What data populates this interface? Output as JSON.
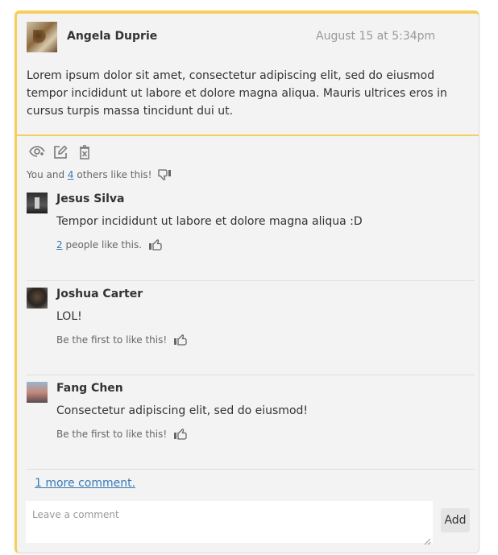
{
  "post": {
    "author": "Angela Duprie",
    "date": "August 15 at 5:34pm",
    "body": "Lorem ipsum dolor sit amet, consectetur adipiscing elit, sed do eiusmod tempor incididunt ut labore et dolore magna aliqua. Mauris ultrices eros in cursus turpis massa tincidunt dui ut.",
    "likes": {
      "prefix": "You and ",
      "count": "4",
      "suffix": " others like this!"
    }
  },
  "actions": {
    "icons": [
      "eye-icon",
      "edit-icon",
      "delete-icon"
    ]
  },
  "comments": [
    {
      "author": "Jesus Silva",
      "text": "Tempor incididunt ut labore et dolore magna aliqua :D",
      "likes_count": "2",
      "likes_text": " people like this."
    },
    {
      "author": "Joshua Carter",
      "text": "LOL!",
      "likes_text": "Be the first to like this!"
    },
    {
      "author": "Fang Chen",
      "text": "Consectetur adipiscing elit, sed do eiusmod!",
      "likes_text": "Be the first to like this!"
    }
  ],
  "more_comments": "1 more comment.",
  "comment_form": {
    "placeholder": "Leave a comment",
    "value": "",
    "add_label": "Add"
  },
  "colors": {
    "accent": "#f4cf5b",
    "link": "#337ab7",
    "card_bg": "#f3f3f3"
  }
}
